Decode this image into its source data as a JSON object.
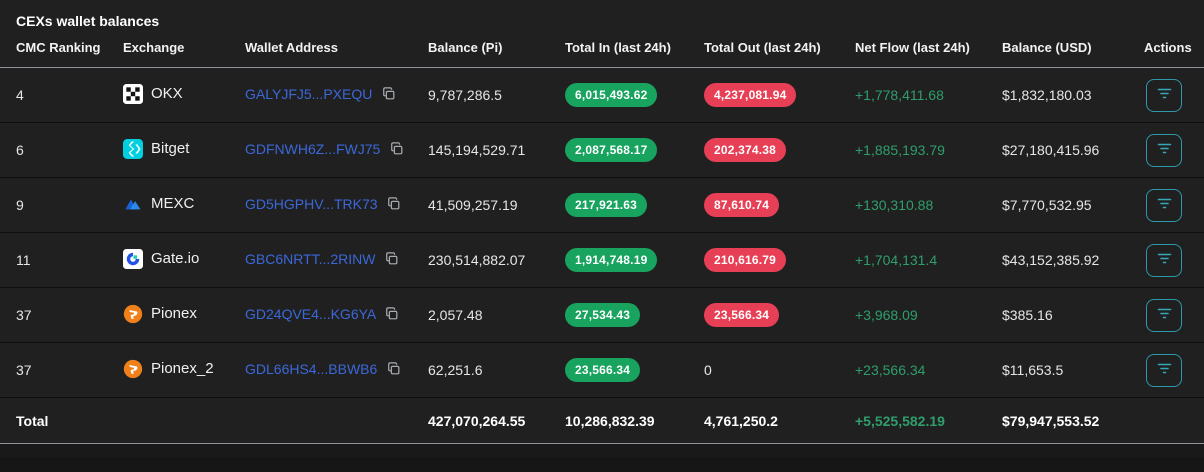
{
  "panel": {
    "title": "CEXs wallet balances"
  },
  "colors": {
    "background": "#202020",
    "address_link": "#3b68d9",
    "badge_green": "#18a35f",
    "badge_red": "#e74056",
    "net_flow_green": "#2f9e6d",
    "action_border_teal": "#2e98aa"
  },
  "table": {
    "columns": [
      "CMC Ranking",
      "Exchange",
      "Wallet Address",
      "Balance (Pi)",
      "Total In (last 24h)",
      "Total Out (last 24h)",
      "Net Flow (last 24h)",
      "Balance (USD)",
      "Actions"
    ],
    "rows": [
      {
        "cmc_ranking": "4",
        "exchange": "OKX",
        "exchange_icon": "okx-logo",
        "wallet_address": "GALYJFJ5...PXEQU",
        "balance_pi": "9,787,286.5",
        "total_in": "6,015,493.62",
        "total_out": "4,237,081.94",
        "total_out_badge": true,
        "net_flow": "+1,778,411.68",
        "balance_usd": "$1,832,180.03"
      },
      {
        "cmc_ranking": "6",
        "exchange": "Bitget",
        "exchange_icon": "bitget-logo",
        "wallet_address": "GDFNWH6Z...FWJ75",
        "balance_pi": "145,194,529.71",
        "total_in": "2,087,568.17",
        "total_out": "202,374.38",
        "total_out_badge": true,
        "net_flow": "+1,885,193.79",
        "balance_usd": "$27,180,415.96"
      },
      {
        "cmc_ranking": "9",
        "exchange": "MEXC",
        "exchange_icon": "mexc-logo",
        "wallet_address": "GD5HGPHV...TRK73",
        "balance_pi": "41,509,257.19",
        "total_in": "217,921.63",
        "total_out": "87,610.74",
        "total_out_badge": true,
        "net_flow": "+130,310.88",
        "balance_usd": "$7,770,532.95"
      },
      {
        "cmc_ranking": "11",
        "exchange": "Gate.io",
        "exchange_icon": "gateio-logo",
        "wallet_address": "GBC6NRTT...2RINW",
        "balance_pi": "230,514,882.07",
        "total_in": "1,914,748.19",
        "total_out": "210,616.79",
        "total_out_badge": true,
        "net_flow": "+1,704,131.4",
        "balance_usd": "$43,152,385.92"
      },
      {
        "cmc_ranking": "37",
        "exchange": "Pionex",
        "exchange_icon": "pionex-logo",
        "wallet_address": "GD24QVE4...KG6YA",
        "balance_pi": "2,057.48",
        "total_in": "27,534.43",
        "total_out": "23,566.34",
        "total_out_badge": true,
        "net_flow": "+3,968.09",
        "balance_usd": "$385.16"
      },
      {
        "cmc_ranking": "37",
        "exchange": "Pionex_2",
        "exchange_icon": "pionex-logo",
        "wallet_address": "GDL66HS4...BBWB6",
        "balance_pi": "62,251.6",
        "total_in": "23,566.34",
        "total_out": "0",
        "total_out_badge": false,
        "net_flow": "+23,566.34",
        "balance_usd": "$11,653.5"
      }
    ],
    "total": {
      "label": "Total",
      "balance_pi": "427,070,264.55",
      "total_in": "10,286,832.39",
      "total_out": "4,761,250.2",
      "net_flow": "+5,525,582.19",
      "balance_usd": "$79,947,553.52"
    }
  }
}
